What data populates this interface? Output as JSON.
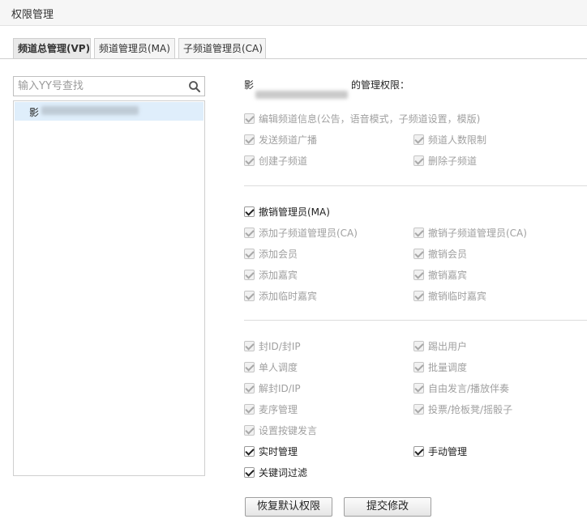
{
  "window": {
    "title": "权限管理"
  },
  "tabs": [
    {
      "label": "频道总管理(VP)",
      "active": true
    },
    {
      "label": "频道管理员(MA)",
      "active": false
    },
    {
      "label": "子频道管理员(CA)",
      "active": false
    }
  ],
  "search": {
    "placeholder": "输入YY号查找",
    "icon": "search-icon"
  },
  "user_list": {
    "items": [
      {
        "prefix": "影"
      }
    ]
  },
  "permissions": {
    "title_prefix": "影",
    "title_suffix": "的管理权限：",
    "section1": [
      {
        "label": "编辑频道信息(公告，语音模式，子频道设置，模版)",
        "checked": true,
        "enabled": false
      },
      {
        "label": "发送频道广播",
        "checked": true,
        "enabled": false
      },
      {
        "label": "频道人数限制",
        "checked": true,
        "enabled": false
      },
      {
        "label": "创建子频道",
        "checked": true,
        "enabled": false
      },
      {
        "label": "删除子频道",
        "checked": true,
        "enabled": false
      }
    ],
    "section2": [
      {
        "label": "撤销管理员(MA)",
        "checked": true,
        "enabled": true
      },
      {
        "label": "添加子频道管理员(CA)",
        "checked": true,
        "enabled": false
      },
      {
        "label": "撤销子频道管理员(CA)",
        "checked": true,
        "enabled": false
      },
      {
        "label": "添加会员",
        "checked": true,
        "enabled": false
      },
      {
        "label": "撤销会员",
        "checked": true,
        "enabled": false
      },
      {
        "label": "添加嘉宾",
        "checked": true,
        "enabled": false
      },
      {
        "label": "撤销嘉宾",
        "checked": true,
        "enabled": false
      },
      {
        "label": "添加临时嘉宾",
        "checked": true,
        "enabled": false
      },
      {
        "label": "撤销临时嘉宾",
        "checked": true,
        "enabled": false
      }
    ],
    "section3": [
      {
        "label": "封ID/封IP",
        "checked": true,
        "enabled": false
      },
      {
        "label": "踢出用户",
        "checked": true,
        "enabled": false
      },
      {
        "label": "单人调度",
        "checked": true,
        "enabled": false
      },
      {
        "label": "批量调度",
        "checked": true,
        "enabled": false
      },
      {
        "label": "解封ID/IP",
        "checked": true,
        "enabled": false
      },
      {
        "label": "自由发言/播放伴奏",
        "checked": true,
        "enabled": false
      },
      {
        "label": "麦序管理",
        "checked": true,
        "enabled": false
      },
      {
        "label": "投票/抢板凳/摇骰子",
        "checked": true,
        "enabled": false
      },
      {
        "label": "设置按键发言",
        "checked": true,
        "enabled": false
      },
      {
        "label": "实时管理",
        "checked": true,
        "enabled": true
      },
      {
        "label": "手动管理",
        "checked": true,
        "enabled": true
      },
      {
        "label": "关键词过滤",
        "checked": true,
        "enabled": true
      }
    ]
  },
  "buttons": {
    "restore_label": "恢复默认权限",
    "submit_label": "提交修改"
  }
}
